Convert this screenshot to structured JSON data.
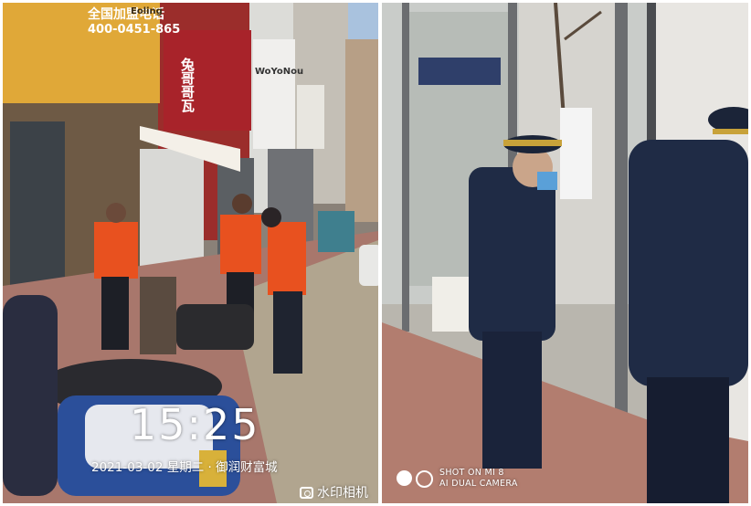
{
  "watermark": {
    "time": "15:25",
    "date_line": "2021-03-02 星期二 · 御润财富城",
    "camera_app": "水印相机",
    "shot_on_line1": "SHOT ON MI 8",
    "shot_on_line2": "AI DUAL CAMERA"
  },
  "storefront_signs": {
    "sign1_line1": "全国加盟电话",
    "sign1_line2": "400-0451-865",
    "sign1_brand": "Eoling",
    "sign2": "兔哥哥瓦",
    "sign3": "WoYoNou"
  },
  "colors": {
    "vest": "#e8511f",
    "uniform": "#1f2b45",
    "cap_band": "#c8a23a",
    "sky": "#a9c2de",
    "pavement": "#a8776c"
  }
}
